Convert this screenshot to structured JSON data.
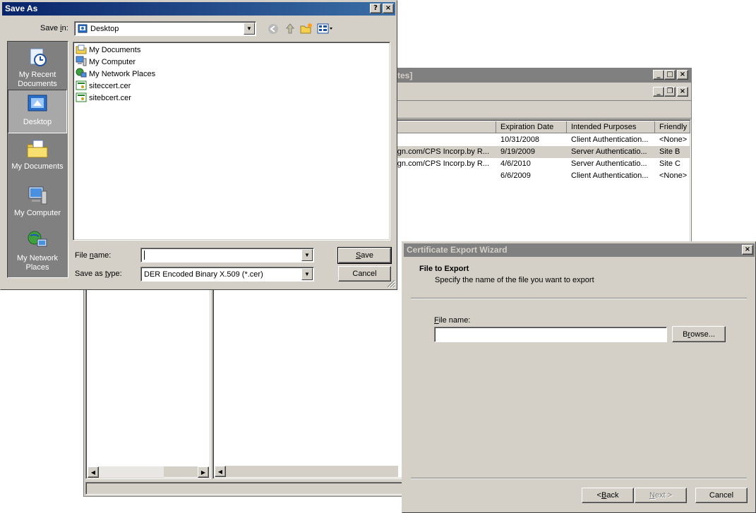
{
  "mmc": {
    "title_fragment": "tes]",
    "columns": [
      "Expiration Date",
      "Intended Purposes",
      "Friendly N"
    ],
    "rows": [
      {
        "issued_by": "",
        "expiration": "10/31/2008",
        "purposes": "Client Authentication...",
        "friendly": "<None>"
      },
      {
        "issued_by": "gn.com/CPS Incorp.by R...",
        "expiration": "9/19/2009",
        "purposes": "Server Authenticatio...",
        "friendly": "Site B"
      },
      {
        "issued_by": "gn.com/CPS Incorp.by R...",
        "expiration": "4/6/2010",
        "purposes": "Server Authenticatio...",
        "friendly": "Site C"
      },
      {
        "issued_by": "",
        "expiration": "6/6/2009",
        "purposes": "Client Authentication...",
        "friendly": "<None>"
      }
    ]
  },
  "save_as": {
    "title": "Save As",
    "save_in_label_pre": "Save ",
    "save_in_label_key": "i",
    "save_in_label_post": "n:",
    "save_in_value": "Desktop",
    "places": [
      {
        "label": "My Recent Documents",
        "icon": "recent-documents-icon"
      },
      {
        "label": "Desktop",
        "icon": "desktop-icon"
      },
      {
        "label": "My Documents",
        "icon": "my-documents-icon"
      },
      {
        "label": "My Computer",
        "icon": "my-computer-icon"
      },
      {
        "label": "My Network Places",
        "icon": "network-places-icon"
      }
    ],
    "files": [
      {
        "name": "My Documents",
        "icon": "folder-icon"
      },
      {
        "name": "My Computer",
        "icon": "computer-icon"
      },
      {
        "name": "My Network Places",
        "icon": "network-icon"
      },
      {
        "name": "siteccert.cer",
        "icon": "certificate-icon"
      },
      {
        "name": "sitebcert.cer",
        "icon": "certificate-icon"
      }
    ],
    "file_name_label_pre": "File ",
    "file_name_label_key": "n",
    "file_name_label_post": "ame:",
    "file_name_value": "",
    "save_as_type_label_pre": "Save as ",
    "save_as_type_label_key": "t",
    "save_as_type_label_post": "ype:",
    "save_as_type_value": "DER Encoded Binary X.509 (*.cer)",
    "save_button_key": "S",
    "save_button_rest": "ave",
    "cancel_button": "Cancel"
  },
  "wizard": {
    "title": "Certificate Export Wizard",
    "heading": "File to Export",
    "subheading": "Specify the name of the file you want to export",
    "file_name_label_key": "F",
    "file_name_label_rest": "ile name:",
    "file_name_value": "",
    "browse_pre": "B",
    "browse_key": "r",
    "browse_post": "owse...",
    "back_pre": "< ",
    "back_key": "B",
    "back_post": "ack",
    "next_key": "N",
    "next_post": "ext >",
    "cancel": "Cancel"
  },
  "colors": {
    "active_title": "#0a246a",
    "inactive_title": "#808080",
    "face": "#d4d0c8",
    "places_bar": "#808080"
  }
}
